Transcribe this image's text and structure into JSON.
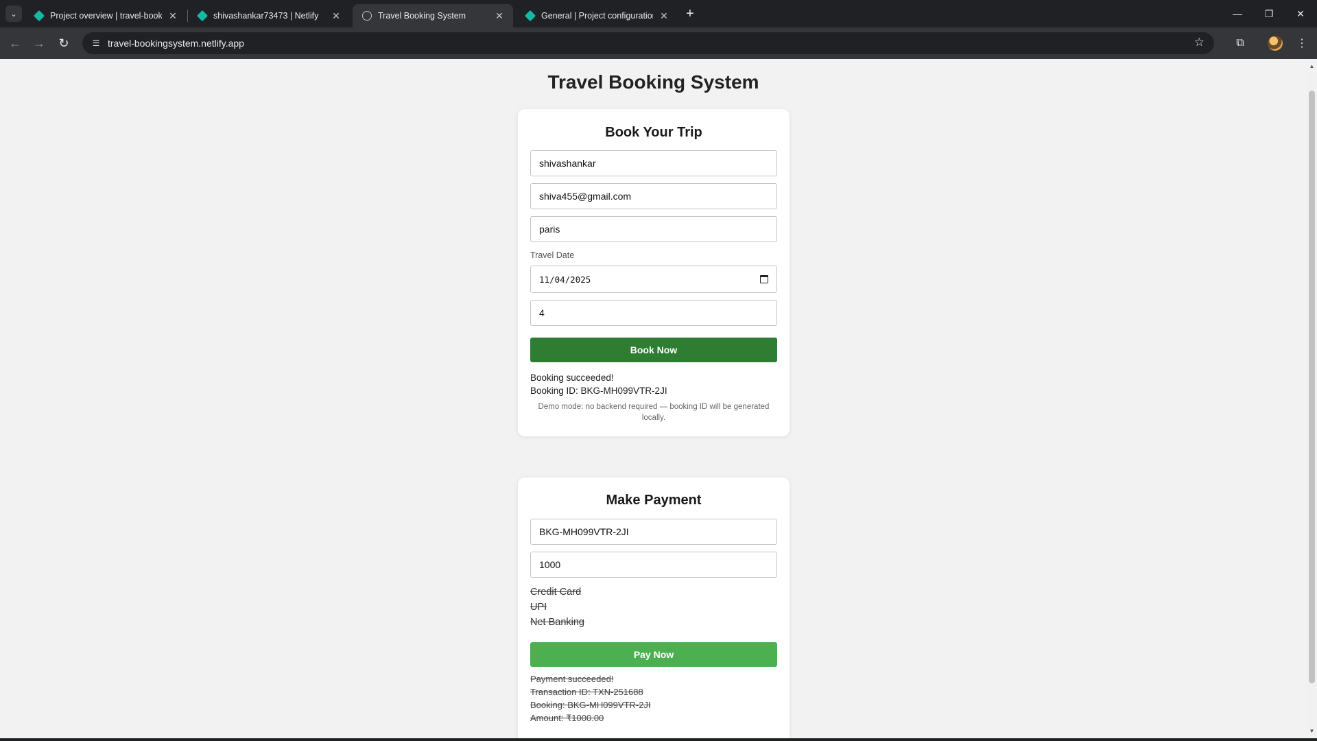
{
  "browser": {
    "tabs": [
      {
        "label": "Project overview | travel-bookin",
        "icon": "netlify-icon"
      },
      {
        "label": "shivashankar73473 | Netlify",
        "icon": "netlify-icon"
      },
      {
        "label": "Travel Booking System",
        "icon": "globe-icon"
      },
      {
        "label": "General | Project configuration |",
        "icon": "netlify-icon"
      }
    ],
    "active_tab_index": 2,
    "url": "travel-bookingsystem.netlify.app",
    "accent_color": "#14b8a6"
  },
  "page": {
    "title": "Travel Booking System"
  },
  "booking": {
    "heading": "Book Your Trip",
    "name_value": "shivashankar",
    "email_value": "shiva455@gmail.com",
    "destination_value": "paris",
    "travel_date_label": "Travel Date",
    "travel_date_value": "11/04/2025",
    "travellers_value": "4",
    "button_label": "Book Now",
    "button_color": "#2e7d32",
    "status_line1": "Booking succeeded!",
    "status_line2": "Booking ID: BKG-MH099VTR-2JI",
    "demo_note": "Demo mode: no backend required — booking ID will be generated locally."
  },
  "payment": {
    "heading": "Make Payment",
    "booking_id_value": "BKG-MH099VTR-2JI",
    "amount_value": "1000",
    "methods": [
      "Credit Card",
      "UPI",
      "Net Banking"
    ],
    "button_label": "Pay Now",
    "button_color": "#4caf50",
    "result": {
      "line1": "Payment succeeded!",
      "line2": "Transaction ID: TXN-251688",
      "line3": "Booking: BKG-MH099VTR-2JI",
      "line4": "Amount: ₹1000.00"
    }
  }
}
